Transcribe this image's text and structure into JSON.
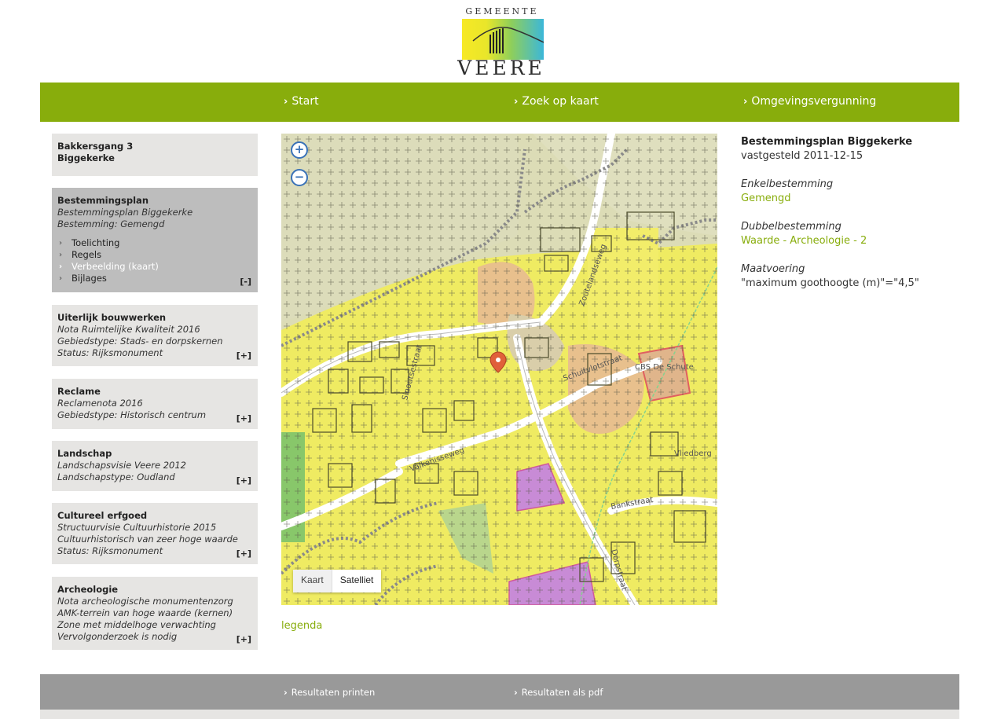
{
  "logo": {
    "top_text": "GEMEENTE",
    "bottom_text": "VEERE"
  },
  "nav": {
    "items": [
      {
        "label": "Start"
      },
      {
        "label": "Zoek op kaart"
      },
      {
        "label": "Omgevingsvergunning"
      }
    ]
  },
  "sidebar": {
    "address": {
      "line1": "Bakkersgang 3",
      "line2": "Biggekerke"
    },
    "bestemmingsplan": {
      "title": "Bestemmingsplan",
      "line1": "Bestemmingsplan Biggekerke",
      "line2": "Bestemming: Gemengd",
      "links": [
        "Toelichting",
        "Regels",
        "Verbeelding (kaart)",
        "Bijlages"
      ],
      "toggle": "[-]"
    },
    "uiterlijk": {
      "title": "Uiterlijk bouwwerken",
      "line1": "Nota Ruimtelijke Kwaliteit 2016",
      "line2": "Gebiedstype: Stads- en dorpskernen",
      "line3": "Status: Rijksmonument",
      "toggle": "[+]"
    },
    "reclame": {
      "title": "Reclame",
      "line1": "Reclamenota 2016",
      "line2": "Gebiedstype: Historisch centrum",
      "toggle": "[+]"
    },
    "landschap": {
      "title": "Landschap",
      "line1": "Landschapsvisie Veere 2012",
      "line2": "Landschapstype: Oudland",
      "toggle": "[+]"
    },
    "cultureel": {
      "title": "Cultureel erfgoed",
      "line1": "Structuurvisie Cultuurhistorie 2015",
      "line2": "Cultuurhistorisch van zeer hoge waarde",
      "line3": "Status: Rijksmonument",
      "toggle": "[+]"
    },
    "archeologie": {
      "title": "Archeologie",
      "line1": "Nota archeologische monumentenzorg",
      "line2": "AMK-terrein van hoge waarde (kernen)",
      "line3": "Zone met middelhoge verwachting",
      "line4": "Vervolgonderzoek is nodig",
      "toggle": "[+]"
    }
  },
  "map": {
    "type_buttons": [
      "Kaart",
      "Satelliet"
    ],
    "street_labels": [
      "Sinoutsestraat",
      "Valkenisseweg",
      "Dorpstraat",
      "Bankstraat",
      "Vliedberg",
      "Schuitvlotstraat",
      "Zoutelandseweg",
      "CBS De Schute"
    ],
    "legend_link": "legenda"
  },
  "info": {
    "title": "Bestemmingsplan Biggekerke",
    "status": "vastgesteld 2011-12-15",
    "enkel_label": "Enkelbestemming",
    "enkel_value": "Gemengd",
    "dubbel_label": "Dubbelbestemming",
    "dubbel_value": "Waarde - Archeologie - 2",
    "maat_label": "Maatvoering",
    "maat_value": "\"maximum goothoogte (m)\"=\"4,5\""
  },
  "footer": {
    "print": "Resultaten printen",
    "pdf": "Resultaten als pdf"
  },
  "colors": {
    "brand_green": "#88ad0c",
    "footer_gray": "#999999",
    "box_gray": "#e6e5e3"
  }
}
